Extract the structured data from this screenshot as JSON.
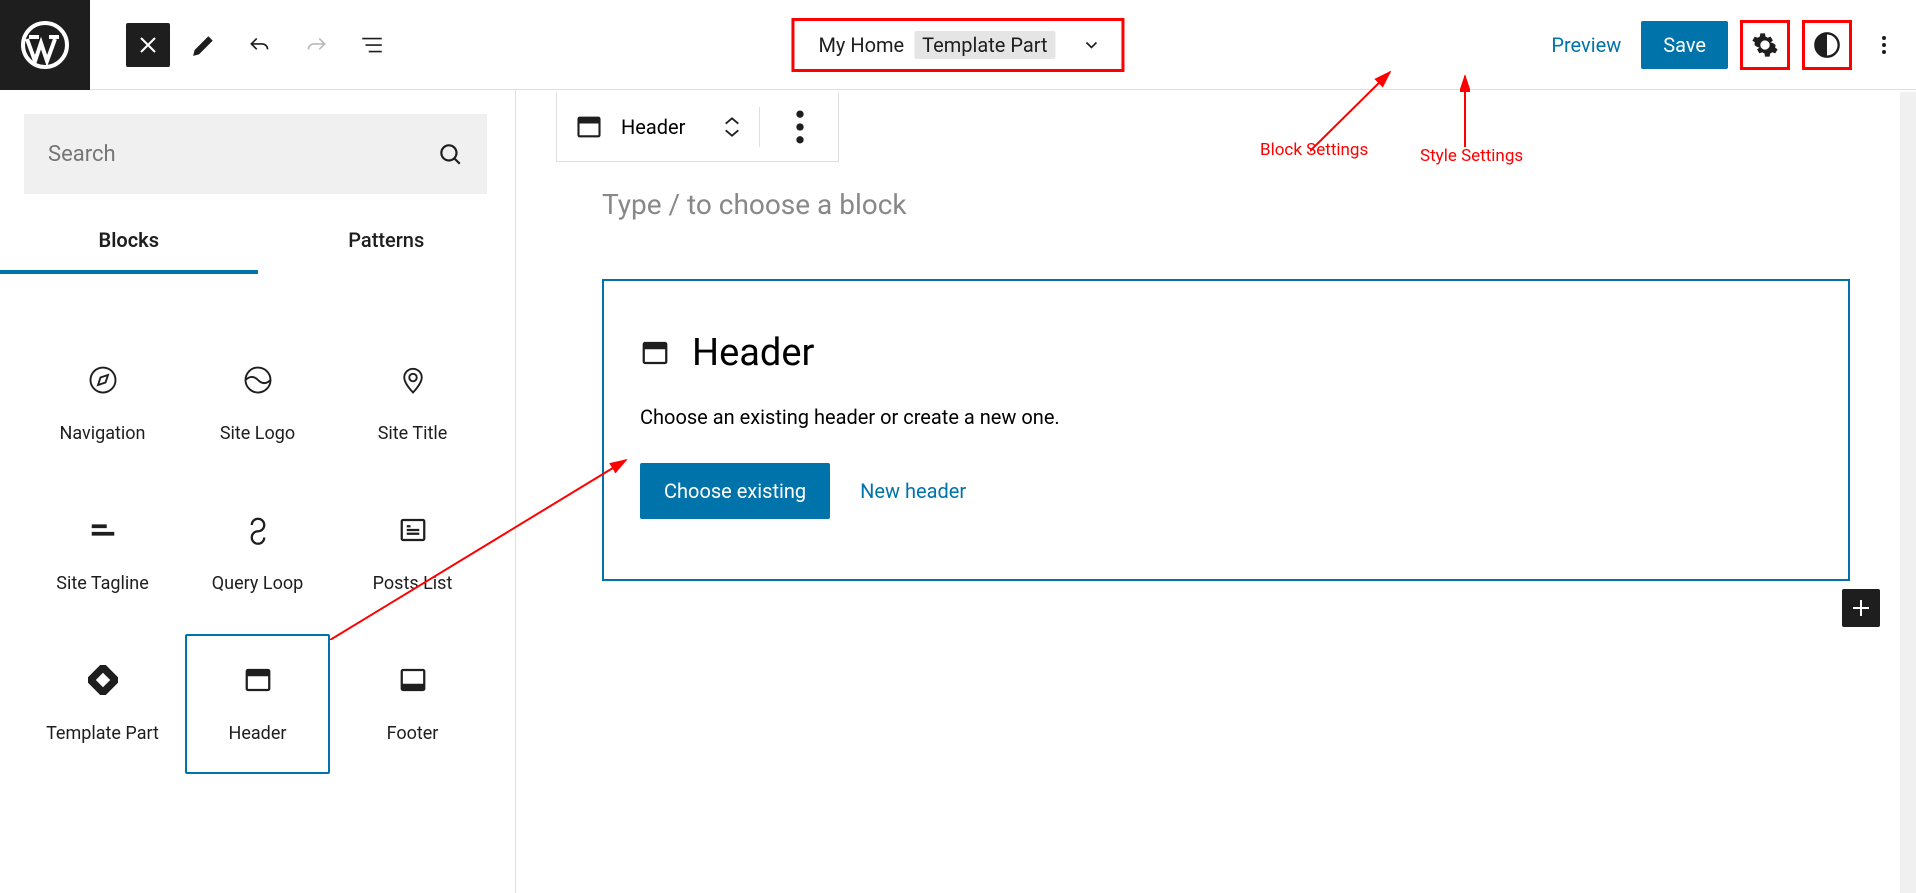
{
  "doc": {
    "name": "My Home",
    "part": "Template Part"
  },
  "top": {
    "preview": "Preview",
    "save": "Save"
  },
  "annotations": {
    "block_settings": "Block Settings",
    "style_settings": "Style Settings"
  },
  "sidebar": {
    "search_placeholder": "Search",
    "tabs": {
      "blocks": "Blocks",
      "patterns": "Patterns"
    },
    "blocks": [
      {
        "label": "Navigation"
      },
      {
        "label": "Site Logo"
      },
      {
        "label": "Site Title"
      },
      {
        "label": "Site Tagline"
      },
      {
        "label": "Query Loop"
      },
      {
        "label": "Posts List"
      },
      {
        "label": "Template Part"
      },
      {
        "label": "Header"
      },
      {
        "label": "Footer"
      }
    ]
  },
  "toolbar": {
    "label": "Header"
  },
  "canvas": {
    "placeholder": "Type / to choose a block",
    "header_block": {
      "title": "Header",
      "desc": "Choose an existing header or create a new one.",
      "choose": "Choose existing",
      "newh": "New header"
    }
  }
}
